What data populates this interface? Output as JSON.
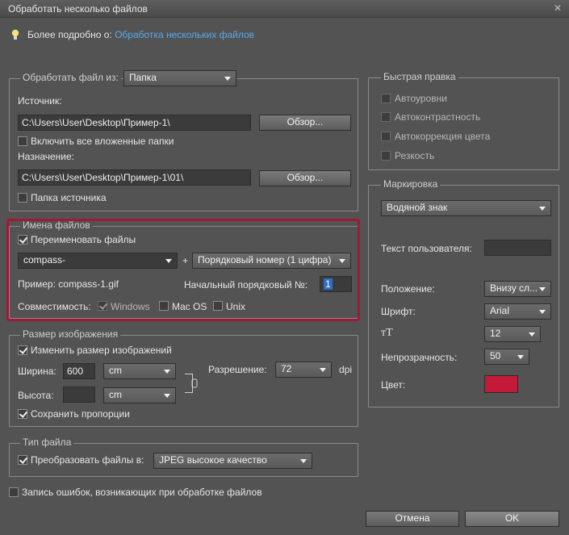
{
  "window": {
    "title": "Обработать несколько файлов",
    "close_glyph": "✕"
  },
  "info": {
    "prefix": "Более подробно о:",
    "link": "Обработка нескольких файлов"
  },
  "source_group": {
    "legend": "Обработать файл из:",
    "mode": "Папка",
    "source_label": "Источник:",
    "source_path": "C:\\Users\\User\\Desktop\\Пример-1\\",
    "browse1": "Обзор...",
    "include_subfolders": "Включить все вложенные папки",
    "dest_label": "Назначение:",
    "dest_path": "C:\\Users\\User\\Desktop\\Пример-1\\01\\",
    "browse2": "Обзор...",
    "source_folder": "Папка источника"
  },
  "filenames_group": {
    "legend": "Имена файлов",
    "rename": "Переименовать файлы",
    "name_field": "compass-",
    "plus": "+",
    "seq": "Порядковый номер (1 цифра)",
    "example": "Пример: compass-1.gif",
    "start_label": "Начальный порядковый №:",
    "start_value": "1",
    "compat_label": "Совместимость:",
    "windows": "Windows",
    "macos": "Mac OS",
    "unix": "Unix"
  },
  "size_group": {
    "legend": "Размер изображения",
    "resize": "Изменить размер изображений",
    "width_label": "Ширина:",
    "width_value": "600",
    "width_unit": "cm",
    "height_label": "Высота:",
    "height_value": "",
    "height_unit": "cm",
    "res_label": "Разрешение:",
    "res_value": "72",
    "res_unit": "dpi",
    "keep": "Сохранить пропорции"
  },
  "type_group": {
    "legend": "Тип файла",
    "convert": "Преобразовать файлы в:",
    "format": "JPEG высокое качество"
  },
  "log_errors": "Запись ошибок, возникающих при обработке файлов",
  "quick_fix": {
    "legend": "Быстрая правка",
    "items": [
      "Автоуровни",
      "Автоконтрастность",
      "Автокоррекция цвета",
      "Резкость"
    ]
  },
  "labels_group": {
    "legend": "Маркировка",
    "type": "Водяной знак",
    "custom_text": "Текст пользователя:",
    "position_label": "Положение:",
    "position_value": "Внизу сл...",
    "font_label": "Шрифт:",
    "font_value": "Arial",
    "size_icon_glyph": "тT",
    "size_value": "12",
    "opacity_label": "Непрозрачность:",
    "opacity_value": "50",
    "color_label": "Цвет:",
    "color_hex": "#c41a3a"
  },
  "buttons": {
    "cancel": "Отмена",
    "ok": "OK"
  }
}
